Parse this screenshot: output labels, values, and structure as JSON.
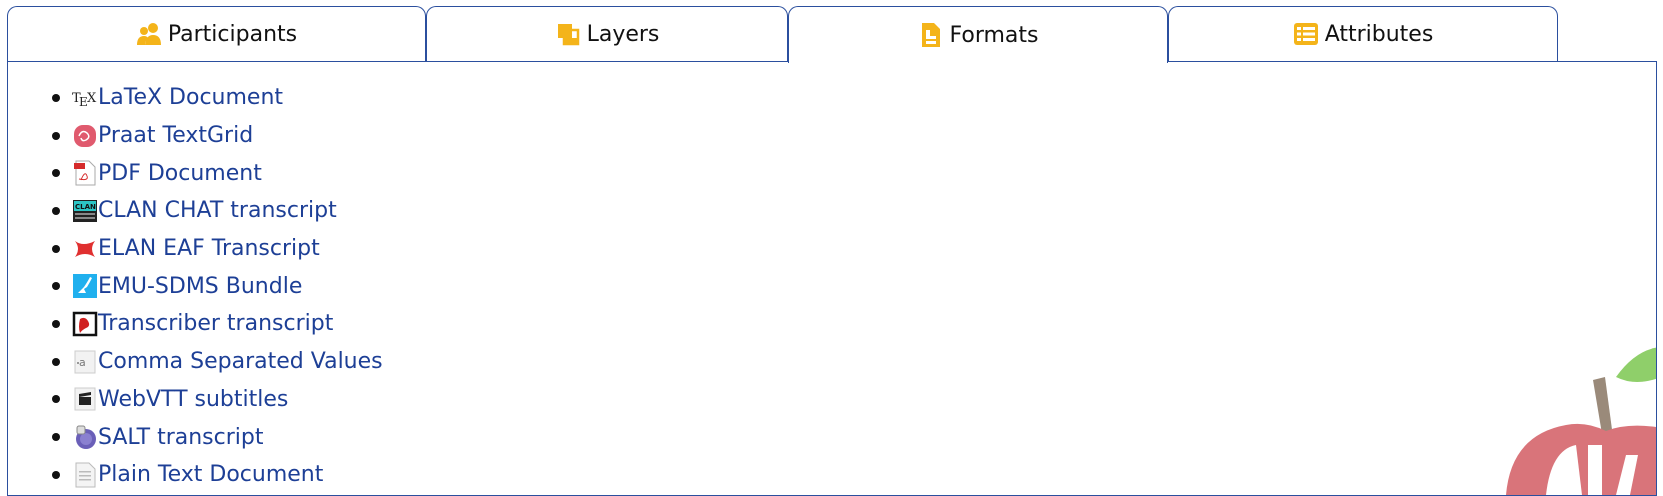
{
  "tabs": [
    {
      "label": "Participants",
      "icon": "participants-icon"
    },
    {
      "label": "Layers",
      "icon": "layers-icon"
    },
    {
      "label": "Formats",
      "icon": "formats-icon",
      "active": true
    },
    {
      "label": "Attributes",
      "icon": "attributes-icon"
    }
  ],
  "formats": [
    {
      "label": "LaTeX Document",
      "icon": "tex-icon"
    },
    {
      "label": "Praat TextGrid",
      "icon": "praat-icon"
    },
    {
      "label": "PDF Document",
      "icon": "pdf-icon"
    },
    {
      "label": "CLAN CHAT transcript",
      "icon": "clan-icon"
    },
    {
      "label": "ELAN EAF Transcript",
      "icon": "elan-icon"
    },
    {
      "label": "EMU-SDMS Bundle",
      "icon": "emu-icon"
    },
    {
      "label": "Transcriber transcript",
      "icon": "transcriber-icon"
    },
    {
      "label": "Comma Separated Values",
      "icon": "csv-icon"
    },
    {
      "label": "WebVTT subtitles",
      "icon": "clapperboard-icon"
    },
    {
      "label": "SALT transcript",
      "icon": "salt-icon"
    },
    {
      "label": "Plain Text Document",
      "icon": "text-document-icon"
    }
  ],
  "colors": {
    "accent": "#f4b41a",
    "border": "#2b4f9e",
    "link": "#1d3f96"
  }
}
